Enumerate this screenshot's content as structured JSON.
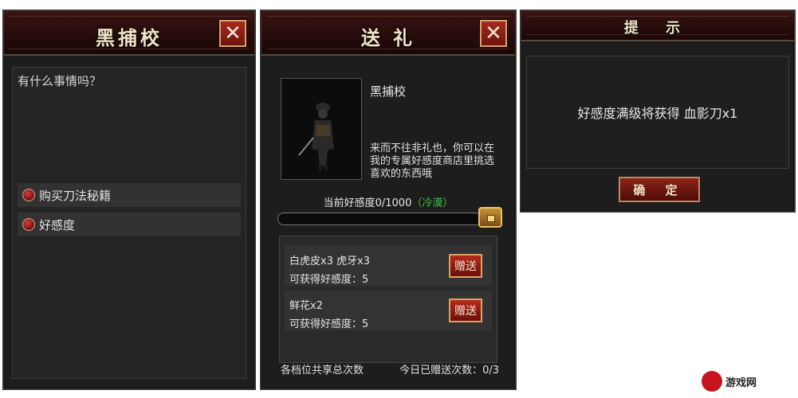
{
  "dialog": {
    "title": "黑捕校",
    "close_label": "✕",
    "question": "有什么事情吗？",
    "options": [
      {
        "label": "购买刀法秘籍"
      },
      {
        "label": "好感度"
      }
    ]
  },
  "gift": {
    "title": "送 礼",
    "close_label": "✕",
    "npc_name": "黑捕校",
    "npc_desc": "来而不往非礼也，你可以在我的专属好感度商店里挑选喜欢的东西哦",
    "favor_label": "当前好感度0/1000",
    "favor_status": "（冷漠）",
    "favor_value": 0,
    "favor_max": 1000,
    "items": [
      {
        "name": "白虎皮x3 虎牙x3",
        "favor": "可获得好感度：5",
        "button": "赠送"
      },
      {
        "name": "鲜花x2",
        "favor": "可获得好感度：5",
        "button": "赠送"
      }
    ],
    "footer_left": "各档位共享总次数",
    "footer_right": "今日已赠送次数：0/3"
  },
  "notice": {
    "title": "提 示",
    "message": "好感度满级将获得 血影刀x1",
    "confirm": "确 定"
  },
  "watermark": {
    "text": "游戏网"
  },
  "colors": {
    "header_red": "#3a1414",
    "button_red": "#b52a1e",
    "status_green": "#3ec23e"
  }
}
